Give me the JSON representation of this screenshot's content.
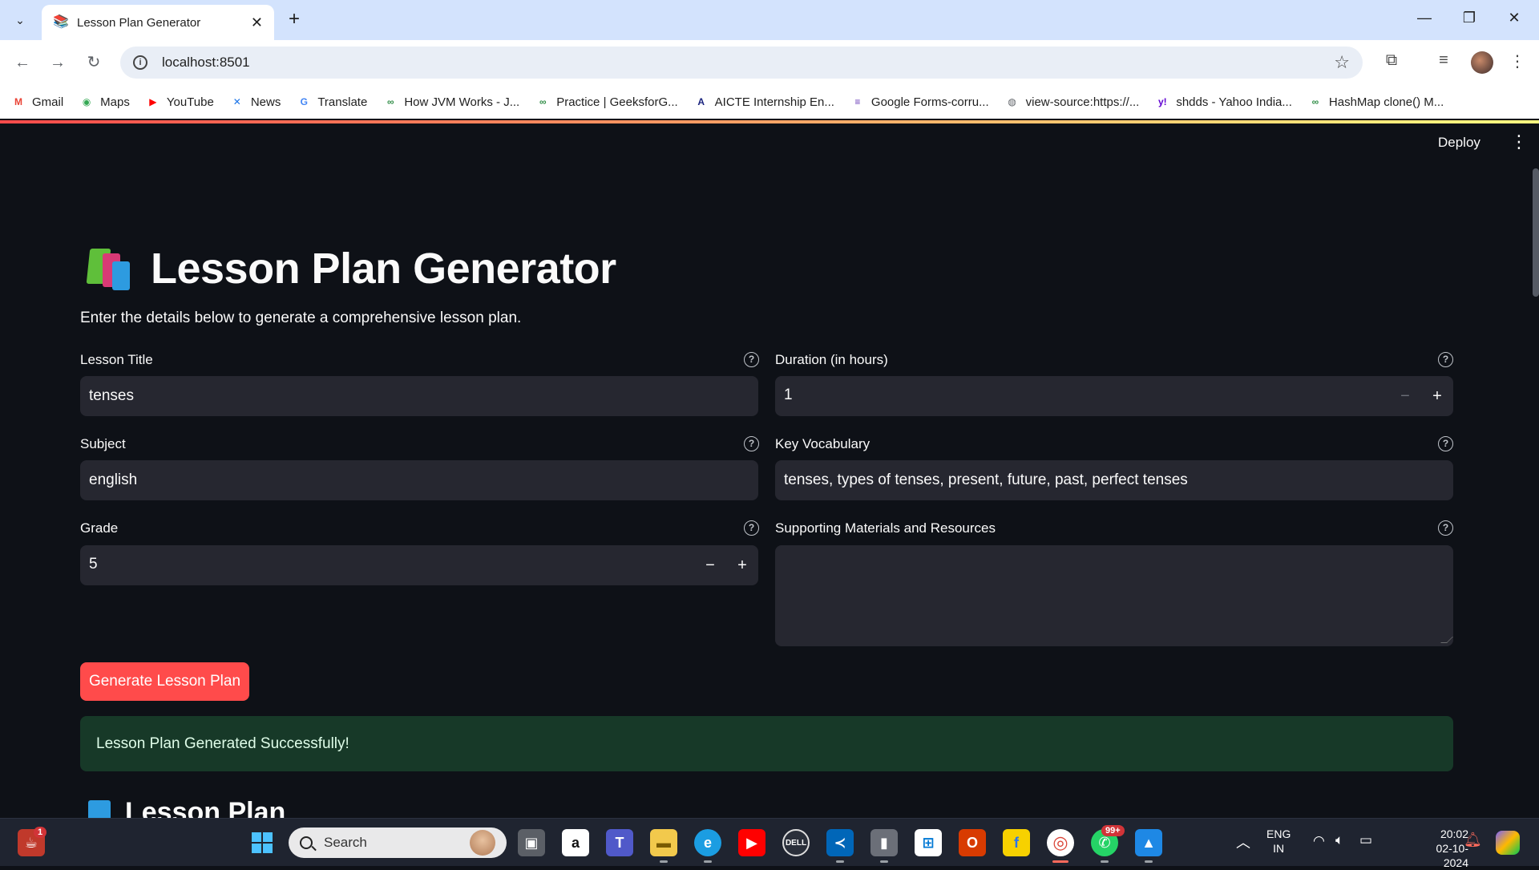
{
  "browser": {
    "tab_title": "Lesson Plan Generator",
    "url": "localhost:8501",
    "bookmarks": [
      {
        "label": "Gmail",
        "icon": "gmail-icon",
        "color": "#ea4335",
        "glyph": "M"
      },
      {
        "label": "Maps",
        "icon": "maps-icon",
        "color": "#34a853",
        "glyph": "◉"
      },
      {
        "label": "YouTube",
        "icon": "youtube-icon",
        "color": "#ff0000",
        "glyph": "▶"
      },
      {
        "label": "News",
        "icon": "news-icon",
        "color": "#1a73e8",
        "glyph": "✕"
      },
      {
        "label": "Translate",
        "icon": "translate-icon",
        "color": "#4285f4",
        "glyph": "G"
      },
      {
        "label": "How JVM Works - J...",
        "icon": "geeksforgeeks-icon",
        "color": "#2f8d46",
        "glyph": "∞"
      },
      {
        "label": "Practice | GeeksforG...",
        "icon": "geeksforgeeks-icon",
        "color": "#2f8d46",
        "glyph": "∞"
      },
      {
        "label": "AICTE Internship En...",
        "icon": "aicte-icon",
        "color": "#1a237e",
        "glyph": "A"
      },
      {
        "label": "Google Forms-corru...",
        "icon": "google-forms-icon",
        "color": "#673ab7",
        "glyph": "≡"
      },
      {
        "label": "view-source:https://...",
        "icon": "globe-icon",
        "color": "#5f6368",
        "glyph": "◍"
      },
      {
        "label": "shdds - Yahoo India...",
        "icon": "yahoo-icon",
        "color": "#6001d2",
        "glyph": "y!"
      },
      {
        "label": "HashMap clone() M...",
        "icon": "geeksforgeeks-icon",
        "color": "#2f8d46",
        "glyph": "∞"
      }
    ]
  },
  "app": {
    "deploy_label": "Deploy",
    "title": "Lesson Plan Generator",
    "subtitle": "Enter the details below to generate a comprehensive lesson plan.",
    "fields": {
      "lesson_title": {
        "label": "Lesson Title",
        "value": "tenses"
      },
      "duration": {
        "label": "Duration (in hours)",
        "value": "1"
      },
      "subject": {
        "label": "Subject",
        "value": "english"
      },
      "key_vocabulary": {
        "label": "Key Vocabulary",
        "value": "tenses, types of tenses, present, future, past, perfect tenses"
      },
      "grade": {
        "label": "Grade",
        "value": "5"
      },
      "materials": {
        "label": "Supporting Materials and Resources",
        "value": ""
      }
    },
    "generate_button": "Generate Lesson Plan",
    "success_message": "Lesson Plan Generated Successfully!",
    "section_title": "Lesson Plan"
  },
  "taskbar": {
    "search_placeholder": "Search",
    "notification_count": "1",
    "whatsapp_badge": "99+",
    "language_line1": "ENG",
    "language_line2": "IN",
    "time": "20:02",
    "date": "02-10-2024"
  },
  "colors": {
    "accent": "#ff4b4b",
    "background": "#0e1117",
    "input_bg": "#262730",
    "success_bg": "#173928"
  }
}
